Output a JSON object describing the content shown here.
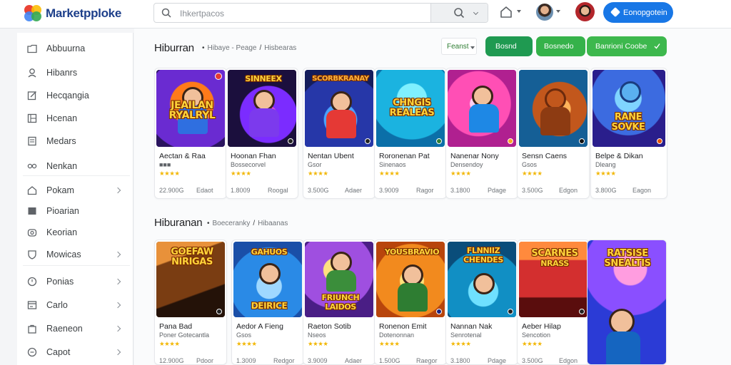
{
  "header": {
    "brand": "Marketpploke",
    "search_placeholder": "Ihkertpacos",
    "cta_label": "Eonopgotein",
    "icons": [
      "logo-icon",
      "search-icon",
      "home-icon",
      "avatar",
      "avatar",
      "bolt-icon"
    ]
  },
  "sidebar": {
    "items": [
      {
        "label": "Abbuurna",
        "icon": "folder-icon",
        "chevron": false
      },
      {
        "label": "Hibanrs",
        "icon": "user-icon",
        "chevron": false
      },
      {
        "label": "Hecqangia",
        "icon": "edit-icon",
        "chevron": false
      },
      {
        "label": "Hcenan",
        "icon": "grid-icon",
        "chevron": false
      },
      {
        "label": "Medars",
        "icon": "document-icon",
        "chevron": false
      },
      {
        "label": "Nenkan",
        "icon": "link-icon",
        "chevron": false
      },
      {
        "label": "Pokam",
        "icon": "home-icon",
        "chevron": true
      },
      {
        "label": "Pioarian",
        "icon": "image-icon",
        "chevron": false
      },
      {
        "label": "Keorian",
        "icon": "camera-icon",
        "chevron": false
      },
      {
        "label": "Mowicas",
        "icon": "shield-icon",
        "chevron": true
      },
      {
        "label": "Ponias",
        "icon": "clock-icon",
        "chevron": true
      },
      {
        "label": "Carlo",
        "icon": "card-icon",
        "chevron": true
      },
      {
        "label": "Raeneon",
        "icon": "bag-icon",
        "chevron": true
      },
      {
        "label": "Capot",
        "icon": "circle-icon",
        "chevron": true
      }
    ]
  },
  "toolbar": {
    "filter_label": "Feanst",
    "buttons": [
      "Bosnd",
      "Bosnedo",
      "Banrioni Coobe"
    ]
  },
  "sections": [
    {
      "title": "Hiburran",
      "subtitle_parts": [
        "Hibaye - Peage",
        "Hisbearas"
      ],
      "cards": [
        {
          "title": "Aectan & Raa",
          "sub": "■■■",
          "stars": "★★★★",
          "meta_left": "22.900G",
          "meta_right": "Edaot",
          "sub_green": true
        },
        {
          "title": "Hoonan Fhan",
          "sub": "Bossecorvel",
          "stars": "★★★★",
          "meta_left": "1.8009",
          "meta_right": "Roogal",
          "sub_green": false
        },
        {
          "title": "Nentan Ubent",
          "sub": "Gsor",
          "stars": "★★★★",
          "meta_left": "3.500G",
          "meta_right": "Adaer",
          "sub_green": false
        },
        {
          "title": "Roronenan Pat",
          "sub": "Sinenaos",
          "stars": "★★★★",
          "meta_left": "3.9009",
          "meta_right": "Ragor",
          "sub_green": false
        },
        {
          "title": "Nanenar Nony",
          "sub": "Densendoy",
          "stars": "★★★★",
          "meta_left": "3.1800",
          "meta_right": "Pdage",
          "sub_green": false
        },
        {
          "title": "Sensn Caens",
          "sub": "Gsos",
          "stars": "★★★★",
          "meta_left": "3.500G",
          "meta_right": "Edgon",
          "sub_green": false
        },
        {
          "title": "Belpe & Dikan",
          "sub": "Dleang",
          "stars": "★★★★",
          "meta_left": "3.800G",
          "meta_right": "Eagon",
          "sub_green": false
        }
      ]
    },
    {
      "title": "Hiburanan",
      "subtitle_parts": [
        "Boeceranky",
        "Hibaanas"
      ],
      "cards": [
        {
          "title": "Pana Bad",
          "sub": "Poner Gotecantla",
          "stars": "★★★★",
          "meta_left": "12.900G",
          "meta_right": "Pdoor",
          "sub_green": false
        },
        {
          "title": "Aedor A Fieng",
          "sub": "Gsos",
          "stars": "★★★★",
          "meta_left": "1.3009",
          "meta_right": "Redgor",
          "sub_green": false
        },
        {
          "title": "Raeton Sotib",
          "sub": "Nseos",
          "stars": "★★★★",
          "meta_left": "3.9009",
          "meta_right": "Adaer",
          "sub_green": false
        },
        {
          "title": "Ronenon Emit",
          "sub": "Dotenonnan",
          "stars": "★★★★",
          "meta_left": "1.500G",
          "meta_right": "Raegor",
          "sub_green": false
        },
        {
          "title": "Nannan Nak",
          "sub": "Senrotenal",
          "stars": "★★★★",
          "meta_left": "3.1800",
          "meta_right": "Pdage",
          "sub_green": false
        },
        {
          "title": "Aeber Hilap",
          "sub": "Sencotion",
          "stars": "★★★★",
          "meta_left": "3.500G",
          "meta_right": "Edgon",
          "sub_green": false
        }
      ]
    }
  ],
  "art_text": [
    [
      "JEAILAN",
      "RYALRYL"
    ],
    [
      "SINNEEX",
      ""
    ],
    [
      "SCORBKRANAY",
      ""
    ],
    [
      "CHNGIS",
      "REALEAS"
    ],
    [
      "",
      ""
    ],
    [
      "",
      ""
    ],
    [
      "RANE",
      "SOVKE"
    ],
    [
      "GOEFAW",
      "NIRIGAS"
    ],
    [
      "GAHUOS",
      "DEIRICE"
    ],
    [
      "FRIUNCH",
      "LAIDOS"
    ],
    [
      "YOUSBRAVIO",
      ""
    ],
    [
      "FLNNIIZ",
      "CHENDES"
    ],
    [
      "SCARNES",
      "NRASS"
    ],
    [
      "RATSISE",
      "SNEALTIS"
    ]
  ],
  "colors": {
    "accent": "#1877e6",
    "green": "#22a34a",
    "brand": "#1d3f8a",
    "star": "#f2b705"
  }
}
